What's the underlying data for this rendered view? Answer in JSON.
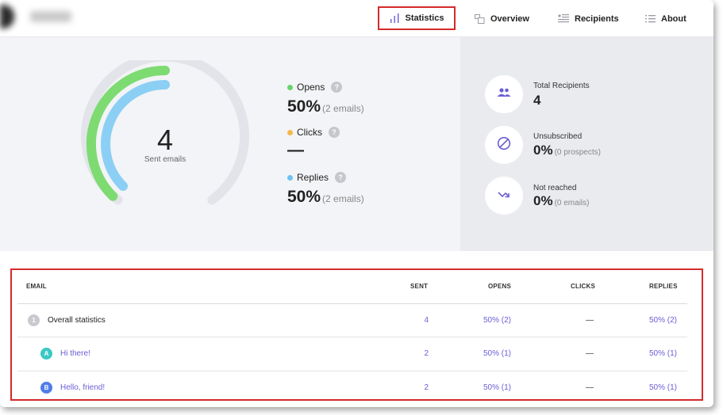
{
  "nav": {
    "statistics": "Statistics",
    "overview": "Overview",
    "recipients": "Recipients",
    "about": "About"
  },
  "gauge": {
    "value": "4",
    "caption": "Sent emails",
    "opens_fraction": 0.5,
    "replies_fraction": 0.5
  },
  "metrics": {
    "opens": {
      "label": "Opens",
      "value": "50%",
      "sub": "(2 emails)",
      "color": "#68d46b"
    },
    "clicks": {
      "label": "Clicks",
      "value": "—",
      "color": "#f5b94a"
    },
    "replies": {
      "label": "Replies",
      "value": "50%",
      "sub": "(2 emails)",
      "color": "#6fc2f0"
    },
    "help": "?"
  },
  "recipients": {
    "total": {
      "label": "Total Recipients",
      "value": "4"
    },
    "unsubscribed": {
      "label": "Unsubscribed",
      "value": "0%",
      "sub": "(0 prospects)"
    },
    "not_reached": {
      "label": "Not reached",
      "value": "0%",
      "sub": "(0 emails)"
    }
  },
  "table": {
    "headers": {
      "email": "EMAIL",
      "sent": "SENT",
      "opens": "OPENS",
      "clicks": "CLICKS",
      "replies": "REPLIES"
    },
    "rows": [
      {
        "badge": "1",
        "label": "Overall statistics",
        "sent": "4",
        "opens": "50% (2)",
        "clicks": "—",
        "replies": "50% (2)"
      },
      {
        "badge": "A",
        "label": "Hi there!",
        "sent": "2",
        "opens": "50% (1)",
        "clicks": "—",
        "replies": "50% (1)"
      },
      {
        "badge": "B",
        "label": "Hello, friend!",
        "sent": "2",
        "opens": "50% (1)",
        "clicks": "—",
        "replies": "50% (1)"
      }
    ]
  },
  "colors": {
    "accent": "#6a5ed6",
    "highlight_border": "#d42a2a",
    "badge_overall": "#c9c9cf",
    "badge_a": "#3cc8c4",
    "badge_b": "#4f7de8"
  }
}
